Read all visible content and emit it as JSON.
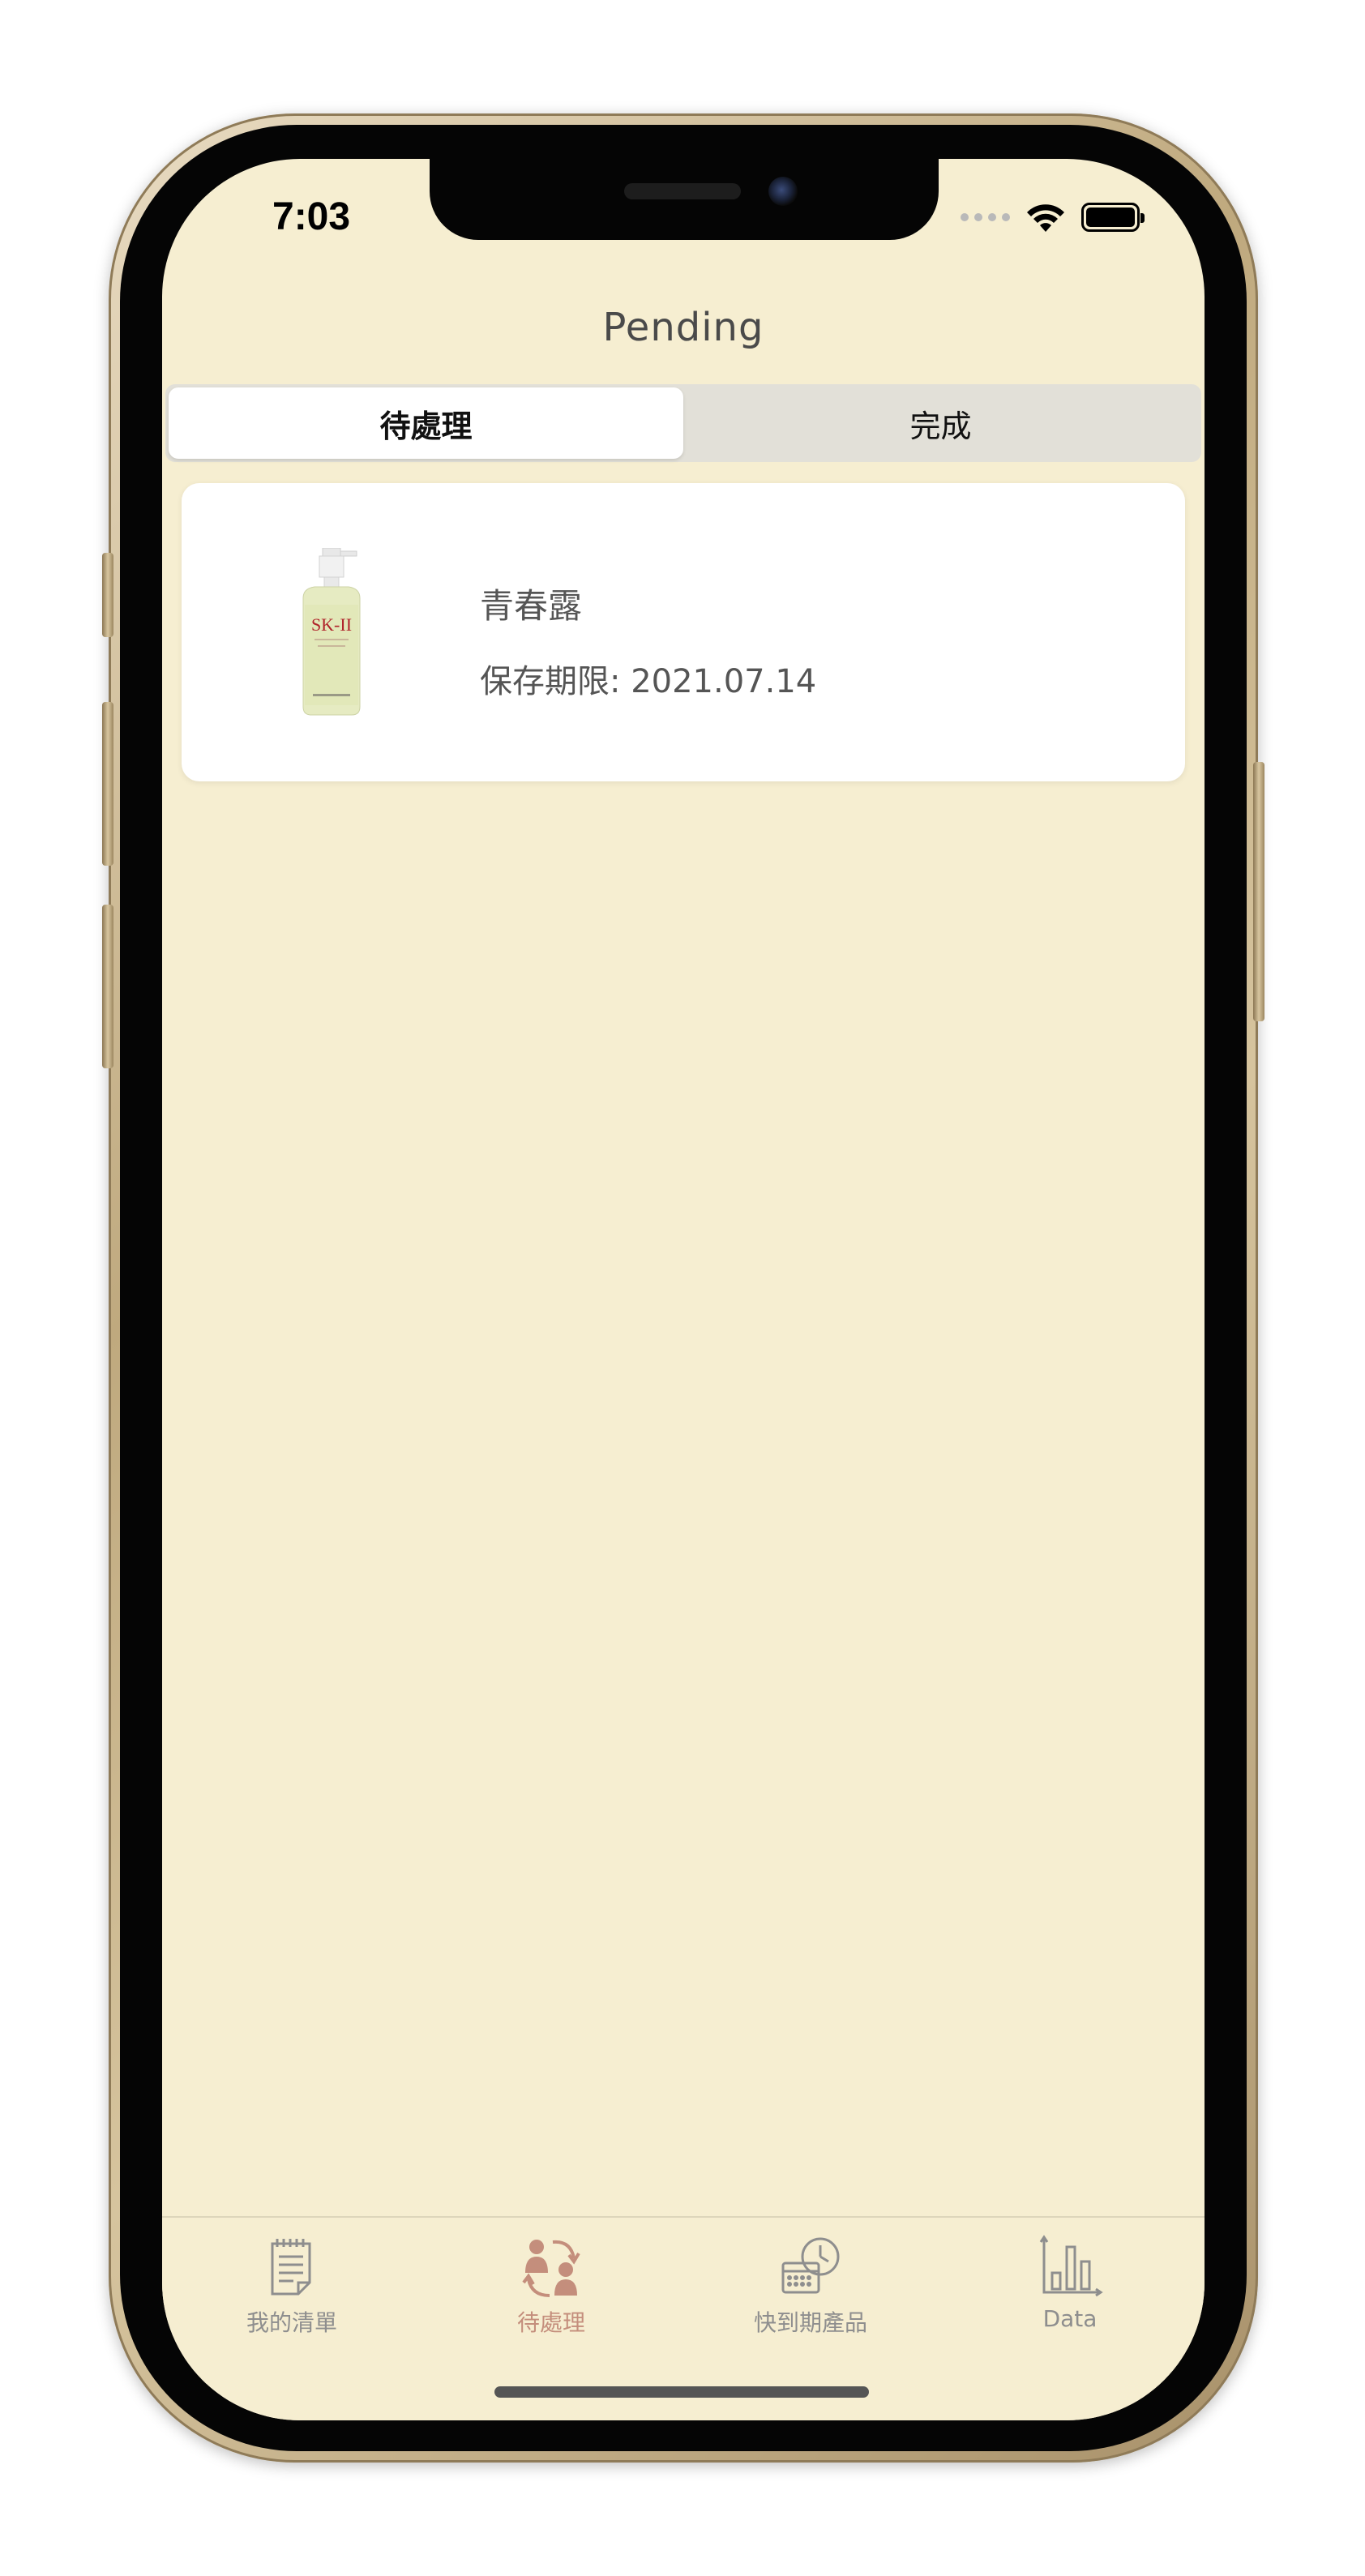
{
  "status_bar": {
    "time": "7:03",
    "wifi_icon": "wifi-icon",
    "battery_icon": "battery-icon"
  },
  "nav": {
    "title": "Pending"
  },
  "segments": {
    "items": [
      {
        "label": "待處理",
        "selected": true
      },
      {
        "label": "完成",
        "selected": false
      }
    ]
  },
  "items": [
    {
      "name": "青春露",
      "expiry": "保存期限: 2021.07.14",
      "thumbnail_brand": "SK-II"
    }
  ],
  "tabbar": {
    "tabs": [
      {
        "label": "我的清單",
        "icon": "notepad-icon",
        "active": false
      },
      {
        "label": "待處理",
        "icon": "people-exchange-icon",
        "active": true
      },
      {
        "label": "快到期產品",
        "icon": "calendar-clock-icon",
        "active": false
      },
      {
        "label": "Data",
        "icon": "bar-chart-icon",
        "active": false
      }
    ]
  },
  "colors": {
    "background": "#f6eed1",
    "active_tab": "#c48e7c",
    "inactive_tab": "#8e8e8e"
  }
}
